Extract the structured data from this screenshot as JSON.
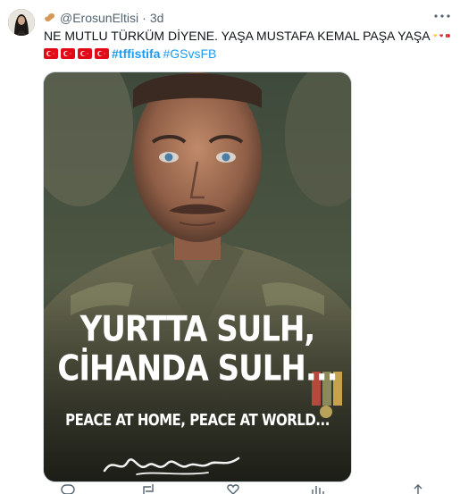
{
  "tweet": {
    "handle": "@ErosunEltisi",
    "separator": "·",
    "time": "3d",
    "text_line1": "NE MUTLU TÜRKÜM DİYENE. YAŞA MUSTAFA KEMAL PAŞA YAŞA",
    "hashtags": [
      "#tffistifa",
      "#GSvsFB"
    ]
  },
  "media": {
    "line1": "YURTTA SULH,",
    "line2": "CİHANDA SULH...",
    "line3": "PEACE AT HOME, PEACE AT WORLD...",
    "signature": "K. Atatürk"
  },
  "icons": {
    "handle_emoji": "peanut-icon",
    "heart_yellow": "yellow-heart-icon",
    "heart_red": "red-heart-icon",
    "flag": "turkey-flag-icon",
    "more": "more-dots-icon"
  },
  "colors": {
    "link": "#1d9bf0",
    "muted": "#536471",
    "flag_red": "#e30a17",
    "heart_yellow": "#ffcc4d",
    "heart_red": "#dd2e44"
  }
}
